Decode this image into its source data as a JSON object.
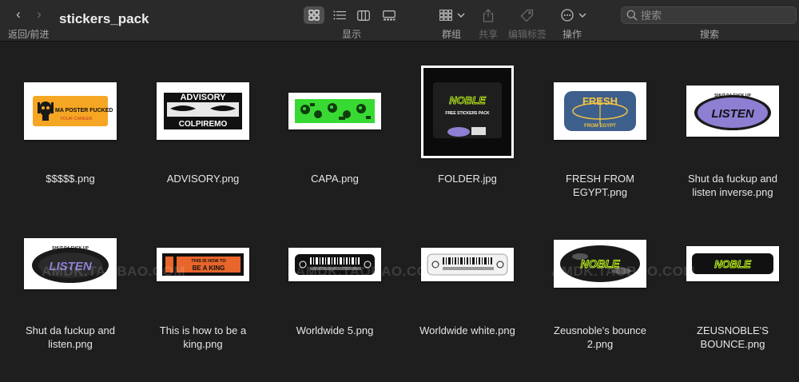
{
  "window": {
    "title": "stickers_pack",
    "nav_label": "返回/前进"
  },
  "toolbar": {
    "display_label": "显示",
    "group_label": "群组",
    "share_label": "共享",
    "tag_label": "编辑标签",
    "action_label": "操作",
    "search_label": "搜索",
    "search_placeholder": "搜索",
    "active_view": "icon-view"
  },
  "files": [
    {
      "name_line1": "$$$$$.png",
      "name_line2": "",
      "thumb_text": "MA POSTER FUCKED",
      "thumb_sub": "YOUR CAREER",
      "color": "#f5a623"
    },
    {
      "name_line1": "ADVISORY.png",
      "name_line2": "",
      "thumb_text": "ADVISORY",
      "thumb_sub": "COLPIREMO",
      "color": "#111111"
    },
    {
      "name_line1": "CAPA.png",
      "name_line2": "",
      "thumb_text": "",
      "thumb_sub": "",
      "color": "#39d934"
    },
    {
      "name_line1": "FOLDER.jpg",
      "name_line2": "",
      "thumb_text": "NOBLE",
      "thumb_sub": "FREE STICKERS PACK",
      "color": "#0b0b0b"
    },
    {
      "name_line1": "FRESH FROM",
      "name_line2": "EGYPT.png",
      "thumb_text": "FRESH",
      "thumb_sub": "FROM EGYPT",
      "color": "#3d5f8c"
    },
    {
      "name_line1": "Shut da fuckup and",
      "name_line2": "listen inverse.png",
      "thumb_text": "LISTEN",
      "thumb_sub": "SHUT DA FUCK UP",
      "color": "#8e7fd3"
    },
    {
      "name_line1": "Shut da fuckup and",
      "name_line2": "listen.png",
      "thumb_text": "LISTEN",
      "thumb_sub": "SHUT DA FUCK UP",
      "color": "#8e7fd3"
    },
    {
      "name_line1": "This is how to be a",
      "name_line2": "king.png",
      "thumb_text": "BE A KING",
      "thumb_sub": "THIS IS HOW TO",
      "color": "#e8652b"
    },
    {
      "name_line1": "Worldwide 5.png",
      "name_line2": "",
      "thumb_text": "",
      "thumb_sub": "",
      "color": "#111111"
    },
    {
      "name_line1": "Worldwide white.png",
      "name_line2": "",
      "thumb_text": "",
      "thumb_sub": "",
      "color": "#f2f2f2"
    },
    {
      "name_line1": "Zeusnoble's bounce",
      "name_line2": "2.png",
      "thumb_text": "NOBLE",
      "thumb_sub": "",
      "color": "#1a1a1a"
    },
    {
      "name_line1": "ZEUSNOBLE'S",
      "name_line2": "BOUNCE.png",
      "thumb_text": "NOBLE",
      "thumb_sub": "",
      "color": "#111111"
    }
  ],
  "watermark": {
    "text_1": "AMDK.TAOBAO.COM",
    "text_2": "AMDK.TAOBAO.COM",
    "text_3": "AMDK.TAOBAO.COM"
  },
  "colors": {
    "background": "#1e1e1e",
    "toolbar": "#2a2a2a",
    "neon_green": "#c6ff1a",
    "text": "#e6e6e6"
  }
}
